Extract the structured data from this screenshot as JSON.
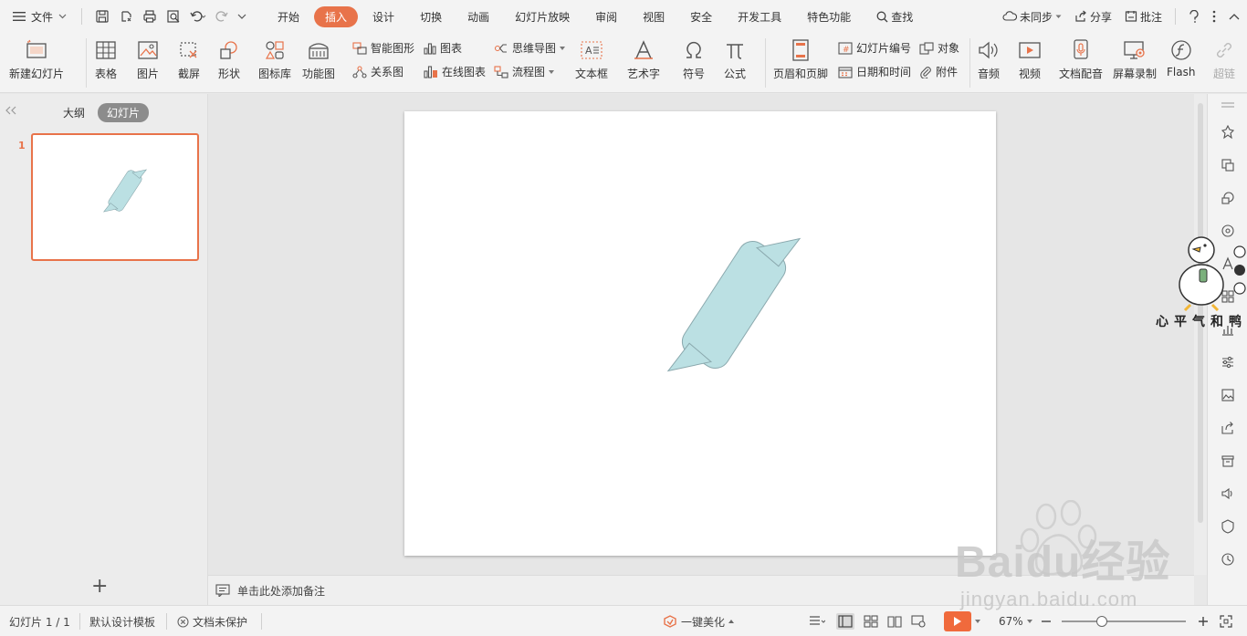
{
  "menubar": {
    "file_label": "文件",
    "tabs": [
      {
        "label": "开始",
        "active": false
      },
      {
        "label": "插入",
        "active": true
      },
      {
        "label": "设计",
        "active": false
      },
      {
        "label": "切换",
        "active": false
      },
      {
        "label": "动画",
        "active": false
      },
      {
        "label": "幻灯片放映",
        "active": false
      },
      {
        "label": "审阅",
        "active": false
      },
      {
        "label": "视图",
        "active": false
      },
      {
        "label": "安全",
        "active": false
      },
      {
        "label": "开发工具",
        "active": false
      },
      {
        "label": "特色功能",
        "active": false
      }
    ],
    "search_label": "查找",
    "sync_label": "未同步",
    "share_label": "分享",
    "comment_label": "批注"
  },
  "ribbon": {
    "new_slide": "新建幻灯片",
    "table": "表格",
    "picture": "图片",
    "screenshot": "截屏",
    "shape": "形状",
    "icon_lib": "图标库",
    "function_chart": "功能图",
    "smart_art": "智能图形",
    "relation": "关系图",
    "chart": "图表",
    "online_chart": "在线图表",
    "mind_map": "思维导图",
    "flow_chart": "流程图",
    "text_box": "文本框",
    "art_text": "艺术字",
    "symbol": "符号",
    "formula": "公式",
    "header_footer": "页眉和页脚",
    "slide_number": "幻灯片编号",
    "object": "对象",
    "date_time": "日期和时间",
    "attachment": "附件",
    "audio": "音频",
    "video": "视频",
    "doc_voice": "文档配音",
    "screen_record": "屏幕录制",
    "flash": "Flash",
    "super_link": "超链"
  },
  "leftpanel": {
    "outline_tab": "大纲",
    "slides_tab": "幻灯片",
    "slide_number": "1",
    "add_symbol": "+"
  },
  "notes": {
    "placeholder": "单击此处添加备注"
  },
  "statusbar": {
    "slide_info": "幻灯片 1 / 1",
    "template": "默认设计模板",
    "protection": "文档未保护",
    "beautify": "一键美化",
    "zoom": "67%"
  },
  "watermark": {
    "sticker_text": "心平气和鸭",
    "brand": "Baidu经验",
    "url": "jingyan.baidu.com"
  },
  "colors": {
    "accent": "#e8734a",
    "shape_fill": "#bbe0e3",
    "shape_stroke": "#8aa8ad"
  }
}
